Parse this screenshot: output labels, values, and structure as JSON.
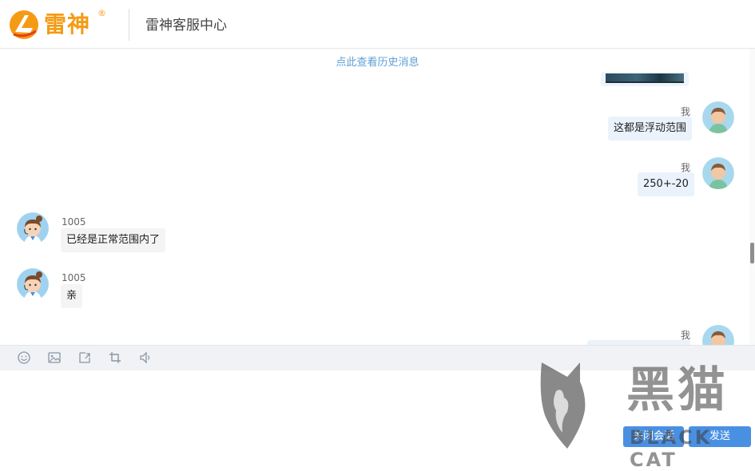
{
  "header": {
    "brand": "雷神",
    "brand_mark": "®",
    "title": "雷神客服中心"
  },
  "chat": {
    "history_link": "点此查看历史消息",
    "messages": [
      {
        "sender": "我",
        "text": "这都是浮动范围",
        "side": "right"
      },
      {
        "sender": "我",
        "text": "250+-20",
        "side": "right"
      },
      {
        "sender": "1005",
        "text": "已经是正常范围内了",
        "side": "left"
      },
      {
        "sender": "1005",
        "text": "亲",
        "side": "left"
      },
      {
        "sender": "我",
        "text": "",
        "side": "right"
      }
    ]
  },
  "toolbar": {
    "icons": [
      "emoji-icon",
      "image-icon",
      "file-upload-icon",
      "crop-icon",
      "volume-icon"
    ]
  },
  "composer": {
    "value": "",
    "placeholder": ""
  },
  "actions": {
    "close_label": "关闭会话",
    "send_label": "发送"
  },
  "watermark": {
    "text_cn": "黑猫",
    "text_en": "BLACK CAT"
  },
  "colors": {
    "brand": "#f59a13",
    "link": "#5e9fd6",
    "me_bubble": "#eaf3fc",
    "other_bubble": "#f4f4f4",
    "toolbar_bg": "#f0f2f5",
    "button": "#4a90e2"
  }
}
